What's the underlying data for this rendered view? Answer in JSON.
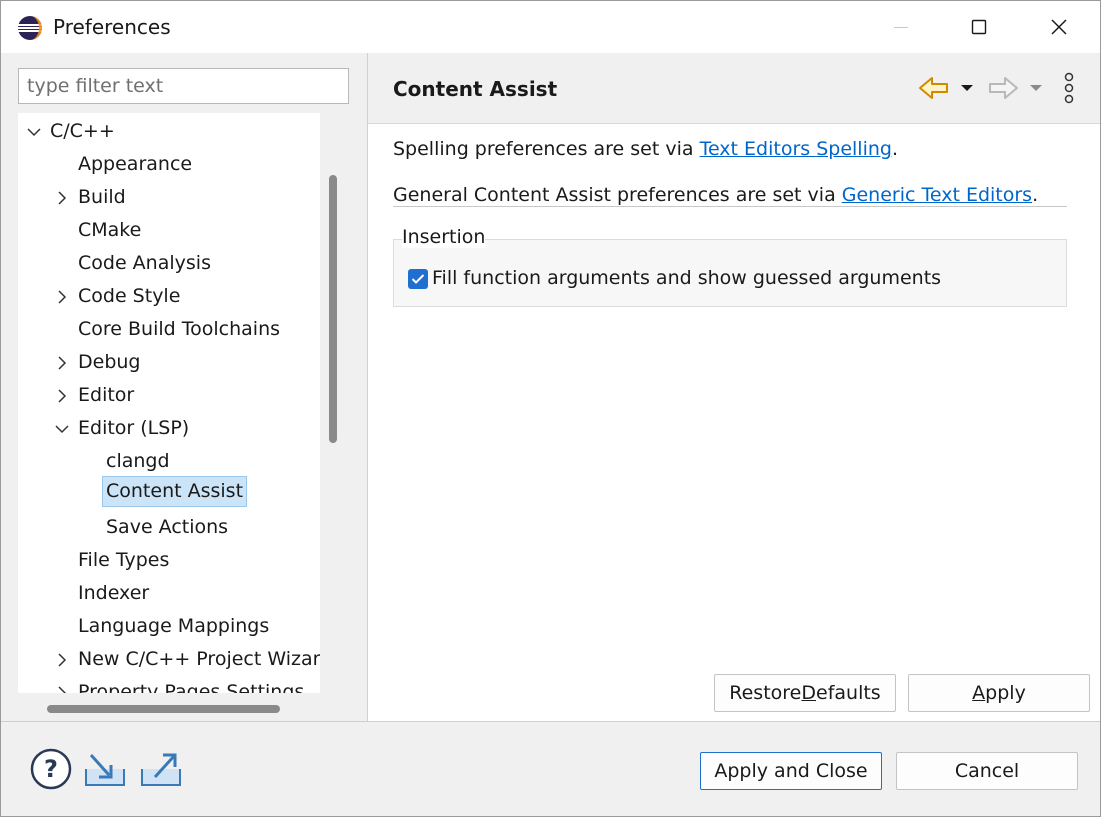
{
  "window": {
    "title": "Preferences"
  },
  "filter": {
    "placeholder": "type filter text",
    "value": ""
  },
  "tree": {
    "items": [
      {
        "label": "C/C++",
        "expanded": true,
        "has_children": true
      },
      {
        "label": "Appearance",
        "has_children": false
      },
      {
        "label": "Build",
        "has_children": true,
        "expanded": false
      },
      {
        "label": "CMake",
        "has_children": false
      },
      {
        "label": "Code Analysis",
        "has_children": false
      },
      {
        "label": "Code Style",
        "has_children": true,
        "expanded": false
      },
      {
        "label": "Core Build Toolchains",
        "has_children": false
      },
      {
        "label": "Debug",
        "has_children": true,
        "expanded": false
      },
      {
        "label": "Editor",
        "has_children": true,
        "expanded": false
      },
      {
        "label": "Editor (LSP)",
        "has_children": true,
        "expanded": true
      },
      {
        "label": "clangd",
        "has_children": false
      },
      {
        "label": "Content Assist",
        "has_children": false,
        "selected": true
      },
      {
        "label": "Save Actions",
        "has_children": false
      },
      {
        "label": "File Types",
        "has_children": false
      },
      {
        "label": "Indexer",
        "has_children": false
      },
      {
        "label": "Language Mappings",
        "has_children": false
      },
      {
        "label": "New C/C++ Project Wizard",
        "has_children": true,
        "expanded": false
      },
      {
        "label": "Property Pages Settings",
        "has_children": true,
        "expanded": false
      }
    ]
  },
  "page": {
    "title": "Content Assist",
    "spelling_prefix": "Spelling preferences are set via ",
    "spelling_link": "Text Editors Spelling",
    "spelling_suffix": ".",
    "general_prefix": "General Content Assist preferences are set via ",
    "general_link": "Generic Text Editors",
    "general_suffix": ".",
    "group_title": "Insertion",
    "checkbox_label": "Fill function arguments and show guessed arguments",
    "checkbox_checked": true
  },
  "buttons": {
    "restore_defaults_pre": "Restore ",
    "restore_defaults_mn": "D",
    "restore_defaults_post": "efaults",
    "apply_mn": "A",
    "apply_post": "pply",
    "apply_and_close": "Apply and Close",
    "cancel": "Cancel"
  },
  "colors": {
    "accent": "#1f6fd1",
    "link": "#0066cc",
    "selection": "#cce4f7"
  },
  "icons": {
    "back": "arrow-left-icon",
    "forward": "arrow-right-icon",
    "menu": "more-vertical-icon",
    "help": "help-icon",
    "import": "import-icon",
    "export": "export-icon"
  }
}
